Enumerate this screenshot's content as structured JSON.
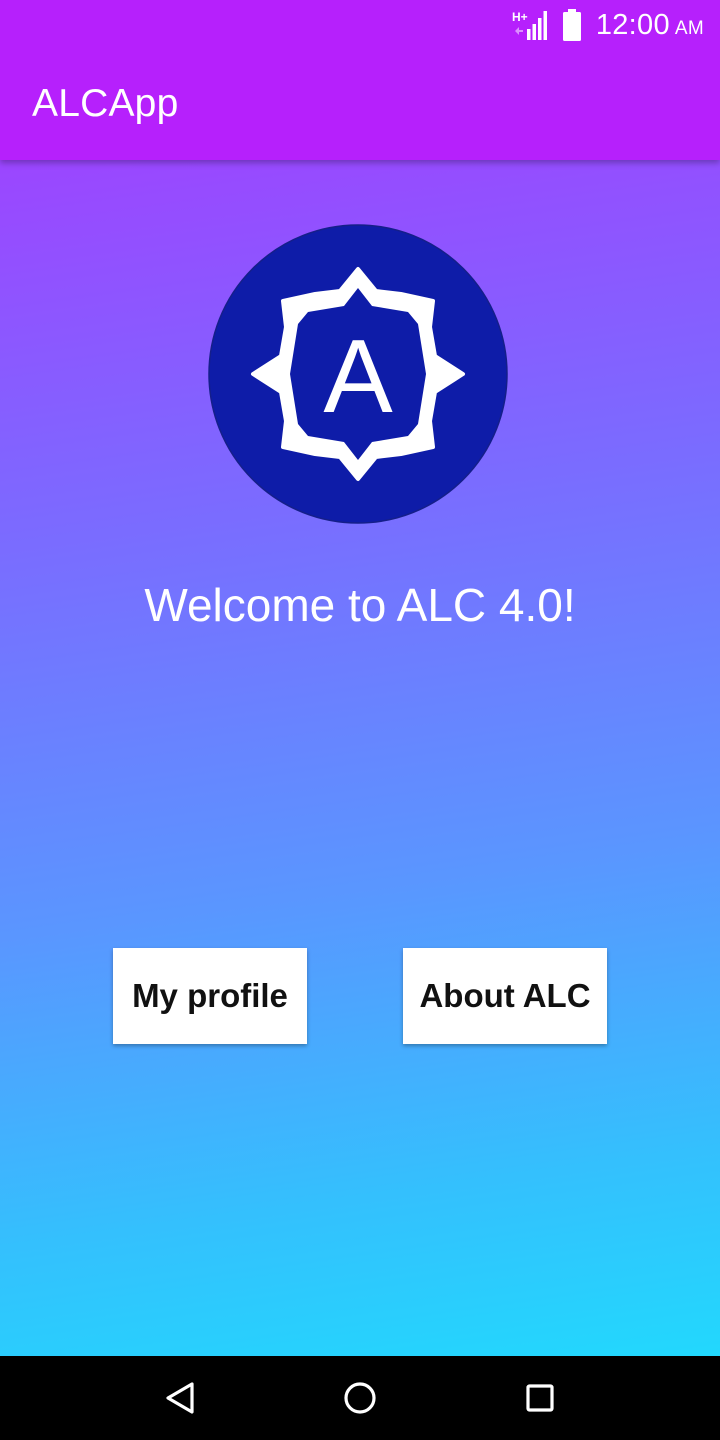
{
  "status_bar": {
    "network_icon": "signal-hplus-icon",
    "network_type": "H+",
    "battery_icon": "battery-full-icon",
    "time": "12:00",
    "ampm": "AM"
  },
  "app_bar": {
    "title": "ALCApp"
  },
  "main": {
    "logo_icon": "alc-logo-icon",
    "logo_letter": "A",
    "welcome_text": "Welcome to ALC 4.0!",
    "buttons": [
      {
        "label": "My profile"
      },
      {
        "label": "About ALC"
      }
    ]
  },
  "nav_bar": {
    "back_icon": "back-triangle-icon",
    "home_icon": "home-circle-icon",
    "recents_icon": "recents-square-icon"
  },
  "colors": {
    "app_bar": "#b620fc",
    "gradient_start": "#9b46ff",
    "gradient_end": "#22d8fd",
    "logo_circle": "#0e1ca8",
    "button_bg": "#ffffff",
    "nav_bar": "#000000"
  }
}
